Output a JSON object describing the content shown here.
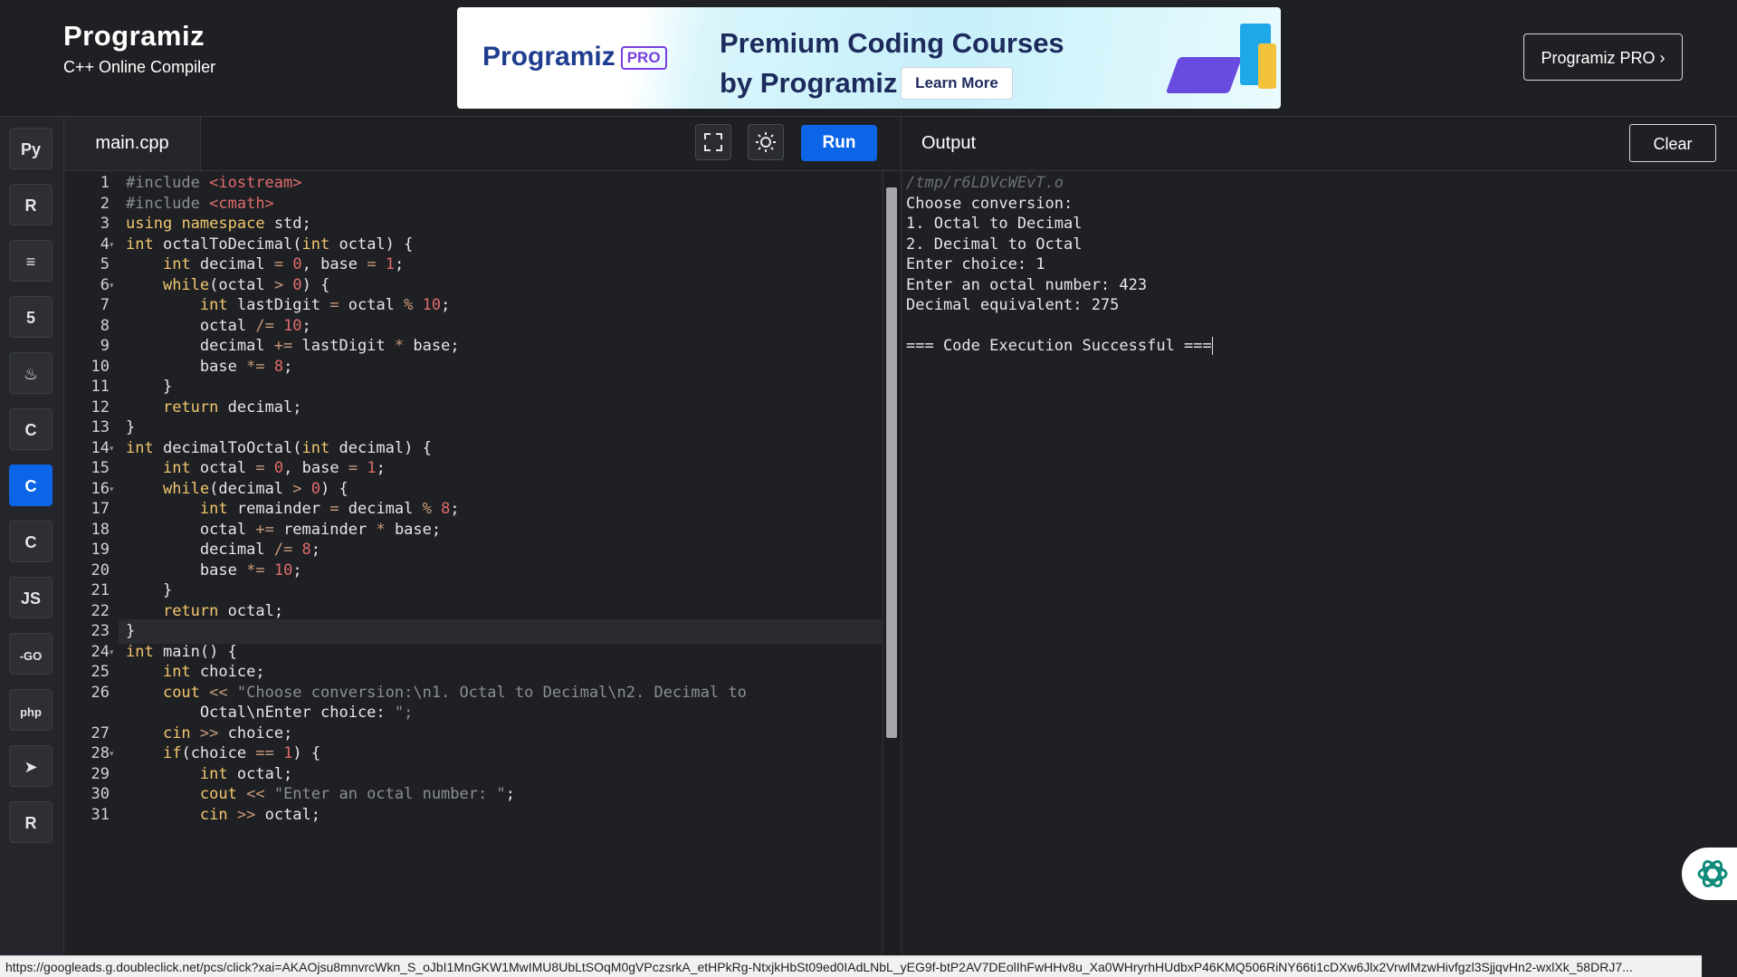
{
  "header": {
    "brand": "Programiz",
    "subtitle": "C++ Online Compiler",
    "pro_button": "Programiz PRO ›"
  },
  "ad": {
    "logo": "Programiz",
    "badge": "PRO",
    "title_line1": "Premium Coding Courses",
    "title_line2": "by Programiz",
    "cta": "Learn More"
  },
  "sidebar": {
    "languages": [
      {
        "name": "python",
        "glyph": "Py"
      },
      {
        "name": "r",
        "glyph": "R"
      },
      {
        "name": "sql",
        "glyph": "≡"
      },
      {
        "name": "html",
        "glyph": "5"
      },
      {
        "name": "java",
        "glyph": "♨"
      },
      {
        "name": "c",
        "glyph": "C"
      },
      {
        "name": "cpp",
        "glyph": "C"
      },
      {
        "name": "csharp",
        "glyph": "C"
      },
      {
        "name": "javascript",
        "glyph": "JS"
      },
      {
        "name": "go",
        "glyph": "-GO"
      },
      {
        "name": "php",
        "glyph": "php"
      },
      {
        "name": "swift",
        "glyph": "➤"
      },
      {
        "name": "rust",
        "glyph": "R"
      }
    ],
    "active": "cpp"
  },
  "editor": {
    "file_tab": "main.cpp",
    "run_label": "Run"
  },
  "code_lines": [
    {
      "n": "1",
      "text": "#include <iostream>"
    },
    {
      "n": "2",
      "text": "#include <cmath>"
    },
    {
      "n": "3",
      "text": "using namespace std;"
    },
    {
      "n": "4",
      "text": "int octalToDecimal(int octal) {"
    },
    {
      "n": "5",
      "text": "    int decimal = 0, base = 1;"
    },
    {
      "n": "6",
      "text": "    while(octal > 0) {"
    },
    {
      "n": "7",
      "text": "        int lastDigit = octal % 10;"
    },
    {
      "n": "8",
      "text": "        octal /= 10;"
    },
    {
      "n": "9",
      "text": "        decimal += lastDigit * base;"
    },
    {
      "n": "10",
      "text": "        base *= 8;"
    },
    {
      "n": "11",
      "text": "    }"
    },
    {
      "n": "12",
      "text": "    return decimal;"
    },
    {
      "n": "13",
      "text": "}"
    },
    {
      "n": "14",
      "text": "int decimalToOctal(int decimal) {"
    },
    {
      "n": "15",
      "text": "    int octal = 0, base = 1;"
    },
    {
      "n": "16",
      "text": "    while(decimal > 0) {"
    },
    {
      "n": "17",
      "text": "        int remainder = decimal % 8;"
    },
    {
      "n": "18",
      "text": "        octal += remainder * base;"
    },
    {
      "n": "19",
      "text": "        decimal /= 8;"
    },
    {
      "n": "20",
      "text": "        base *= 10;"
    },
    {
      "n": "21",
      "text": "    }"
    },
    {
      "n": "22",
      "text": "    return octal;"
    },
    {
      "n": "23",
      "text": "}"
    },
    {
      "n": "24",
      "text": "int main() {"
    },
    {
      "n": "25",
      "text": "    int choice;"
    },
    {
      "n": "26",
      "text": "    cout << \"Choose conversion:\\n1. Octal to Decimal\\n2. Decimal to"
    },
    {
      "n": "",
      "text": "        Octal\\nEnter choice: \";"
    },
    {
      "n": "27",
      "text": "    cin >> choice;"
    },
    {
      "n": "28",
      "text": "    if(choice == 1) {"
    },
    {
      "n": "29",
      "text": "        int octal;"
    },
    {
      "n": "30",
      "text": "        cout << \"Enter an octal number: \";"
    },
    {
      "n": "31",
      "text": "        cin >> octal;"
    }
  ],
  "output": {
    "title": "Output",
    "clear_label": "Clear",
    "lines": [
      "/tmp/r6LDVcWEvT.o",
      "Choose conversion:",
      "1. Octal to Decimal",
      "2. Decimal to Octal",
      "Enter choice: 1",
      "Enter an octal number: 423",
      "Decimal equivalent: 275",
      "",
      "=== Code Execution Successful ==="
    ]
  },
  "statusbar": {
    "url": "https://googleads.g.doubleclick.net/pcs/click?xai=AKAOjsu8mnvrcWkn_S_oJbI1MnGKW1MwIMU8UbLtSOqM0gVPczsrkA_etHPkRg-NtxjkHbSt09ed0IAdLNbL_yEG9f-btP2AV7DEolIhFwHHv8u_Xa0WHryrhHUdbxP46KMQ506RiNY66ti1cDXw6Jlx2VrwlMzwHivfgzl3SjjqvHn2-wxlXk_58DRJ7..."
  }
}
